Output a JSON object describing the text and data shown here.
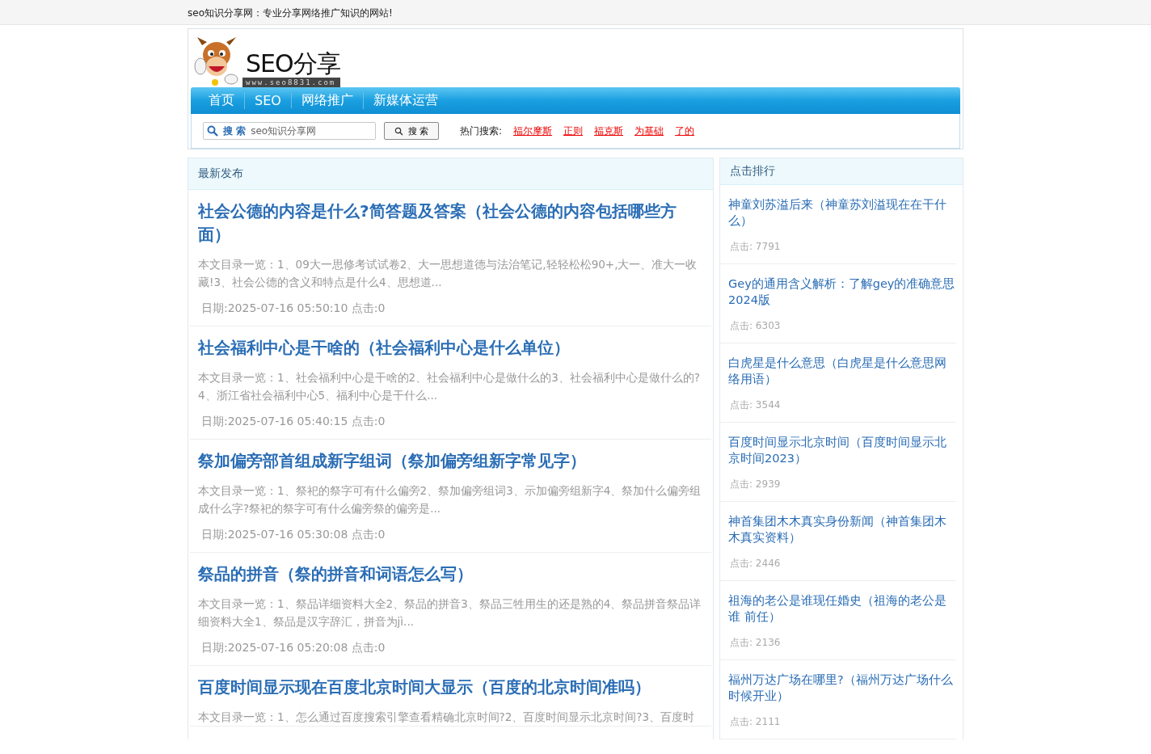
{
  "top_bar": {
    "slogan": "seo知识分享网：专业分享网络推广知识的网站!"
  },
  "logo": {
    "title": "SEO分享",
    "domain": "www.seo8831.com"
  },
  "nav": [
    {
      "label": "首页"
    },
    {
      "label": "SEO"
    },
    {
      "label": "网络推广"
    },
    {
      "label": "新媒体运营"
    }
  ],
  "search": {
    "label": "搜 索",
    "placeholder": "seo知识分享网",
    "button": "搜 索",
    "hot_label": "热门搜索:",
    "hot_links": [
      "福尔摩斯",
      "正则",
      "福克斯",
      "为基础",
      "了的"
    ]
  },
  "latest": {
    "title": "最新发布",
    "articles": [
      {
        "title": "社会公德的内容是什么?简答题及答案（社会公德的内容包括哪些方面）",
        "summary": "本文目录一览：1、09大一思修考试试卷2、大一思想道德与法治笔记,轻轻松松90+,大一、准大一收藏!3、社会公德的含义和特点是什么4、思想道...",
        "meta": "日期:2025-07-16 05:50:10 点击:0"
      },
      {
        "title": "社会福利中心是干啥的（社会福利中心是什么单位）",
        "summary": "本文目录一览：1、社会福利中心是干啥的2、社会福利中心是做什么的3、社会福利中心是做什么的?4、浙江省社会福利中心5、福利中心是干什么...",
        "meta": "日期:2025-07-16 05:40:15 点击:0"
      },
      {
        "title": "祭加偏旁部首组成新字组词（祭加偏旁组新字常见字）",
        "summary": "本文目录一览：1、祭祀的祭字可有什么偏旁2、祭加偏旁组词3、示加偏旁组新字4、祭加什么偏旁组成什么字?祭祀的祭字可有什么偏旁祭的偏旁是...",
        "meta": "日期:2025-07-16 05:30:08 点击:0"
      },
      {
        "title": "祭品的拼音（祭的拼音和词语怎么写）",
        "summary": "本文目录一览：1、祭品详细资料大全2、祭品的拼音3、祭品三牲用生的还是熟的4、祭品拼音祭品详细资料大全1、祭品是汉字辞汇，拼音为jì...",
        "meta": "日期:2025-07-16 05:20:08 点击:0"
      },
      {
        "title": "百度时间显示现在百度北京时间大显示（百度的北京时间准吗）",
        "summary": "本文目录一览：1、怎么通过百度搜索引擎查看精确北京时间?2、百度时间显示北京时间?3、百度时"
      }
    ]
  },
  "ranking": {
    "title": "点击排行",
    "items": [
      {
        "title": "神童刘苏溢后来（神童苏刘溢现在在干什么）",
        "clicks": "点击: 7791"
      },
      {
        "title": "Gey的通用含义解析：了解gey的准确意思 2024版",
        "clicks": "点击: 6303"
      },
      {
        "title": "白虎星是什么意思（白虎星是什么意思网络用语）",
        "clicks": "点击: 3544"
      },
      {
        "title": "百度时间显示北京时间（百度时间显示北京时间2023）",
        "clicks": "点击: 2939"
      },
      {
        "title": "神首集团木木真实身份新闻（神首集团木木真实资料）",
        "clicks": "点击: 2446"
      },
      {
        "title": "祖海的老公是谁现任婚史（祖海的老公是谁 前任）",
        "clicks": "点击: 2136"
      },
      {
        "title": "福州万达广场在哪里?（福州万达广场什么时候开业）",
        "clicks": "点击: 2111"
      }
    ]
  }
}
